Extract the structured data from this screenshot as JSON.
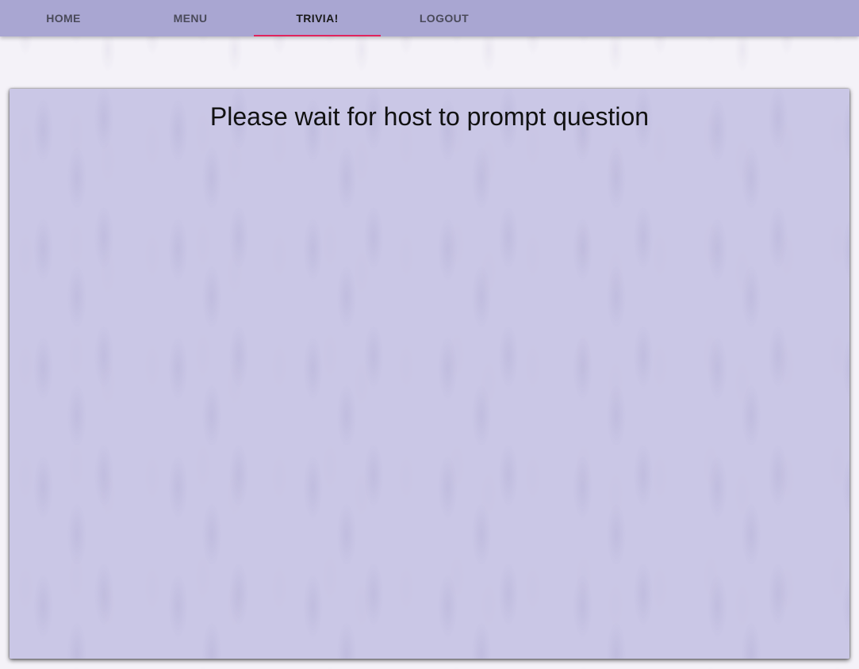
{
  "nav": {
    "tabs": [
      {
        "label": "HOME"
      },
      {
        "label": "MENU"
      },
      {
        "label": "TRIVIA!",
        "active": true
      },
      {
        "label": "LOGOUT"
      }
    ],
    "accent_color": "#e0245e",
    "bar_color": "#a9a6d2"
  },
  "main": {
    "message": "Please wait for host to prompt question"
  }
}
